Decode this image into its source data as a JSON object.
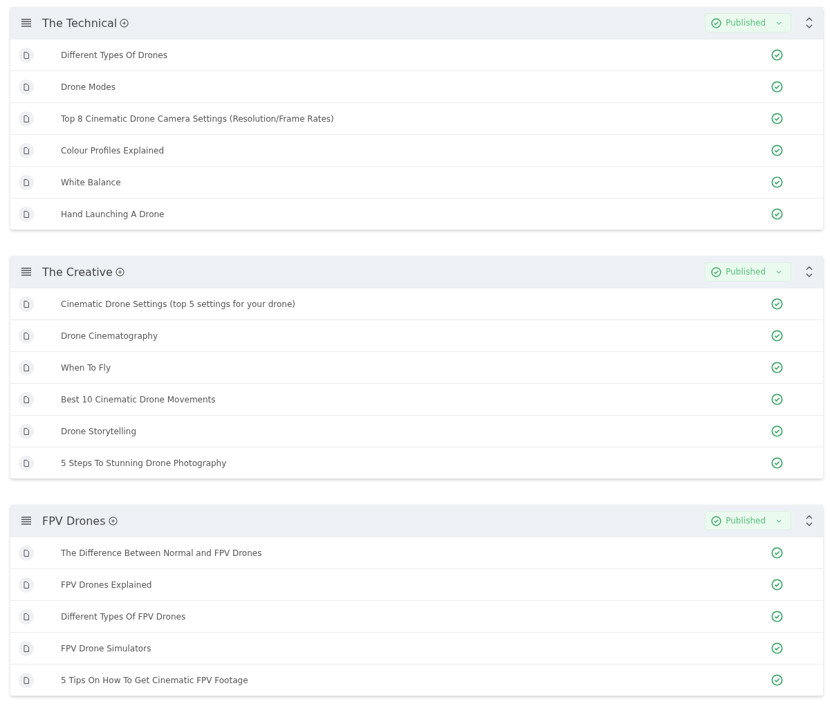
{
  "sections": [
    {
      "title": "The Technical",
      "status": "Published",
      "lessons": [
        {
          "title": "Different Types Of Drones",
          "published": true
        },
        {
          "title": "Drone Modes",
          "published": true
        },
        {
          "title": "Top 8 Cinematic Drone Camera Settings (Resolution/Frame Rates)",
          "published": true
        },
        {
          "title": "Colour Profiles Explained",
          "published": true
        },
        {
          "title": "White Balance",
          "published": true
        },
        {
          "title": "Hand Launching A Drone",
          "published": true
        }
      ]
    },
    {
      "title": "The Creative",
      "status": "Published",
      "lessons": [
        {
          "title": "Cinematic Drone Settings (top 5 settings for your drone)",
          "published": true
        },
        {
          "title": "Drone Cinematography",
          "published": true
        },
        {
          "title": "When To Fly",
          "published": true
        },
        {
          "title": "Best 10 Cinematic Drone Movements",
          "published": true
        },
        {
          "title": "Drone Storytelling",
          "published": true
        },
        {
          "title": "5 Steps To Stunning Drone Photography",
          "published": true
        }
      ]
    },
    {
      "title": "FPV Drones",
      "status": "Published",
      "lessons": [
        {
          "title": "The Difference Between Normal and FPV Drones",
          "published": true
        },
        {
          "title": "FPV Drones Explained",
          "published": true
        },
        {
          "title": "Different Types Of FPV Drones",
          "published": true
        },
        {
          "title": "FPV Drone Simulators",
          "published": true
        },
        {
          "title": "5 Tips On How To Get Cinematic FPV Footage",
          "published": true
        }
      ]
    }
  ]
}
